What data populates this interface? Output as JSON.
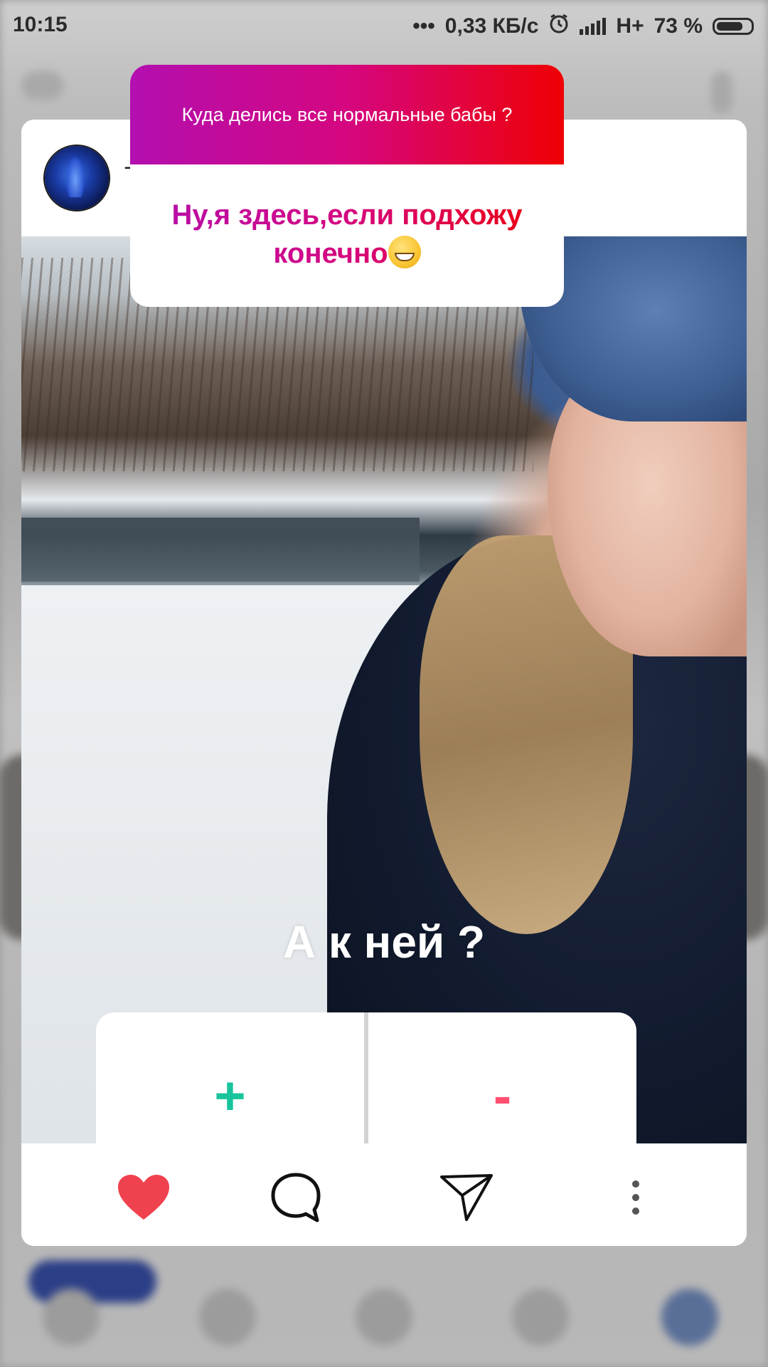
{
  "status_bar": {
    "time": "10:15",
    "dots": "•••",
    "net_speed": "0,33 КБ/с",
    "network": "H+",
    "battery": "73 %"
  },
  "story": {
    "username_fragment": "T",
    "question_sticker": {
      "question": "Куда делись все нормальные бабы ?",
      "answer": "Ну,я здесь,если подхожу конечно"
    },
    "poll": {
      "question": "А к ней ?",
      "option_yes": "+",
      "option_no": "-"
    }
  },
  "colors": {
    "gradient_start": "#b30fb0",
    "gradient_end": "#ef0004",
    "like": "#f0414f",
    "poll_yes": "#19c49c",
    "poll_no": "#ff4f6f"
  },
  "actions": {
    "icons": [
      "heart-icon",
      "comment-icon",
      "send-icon",
      "more-icon"
    ]
  }
}
